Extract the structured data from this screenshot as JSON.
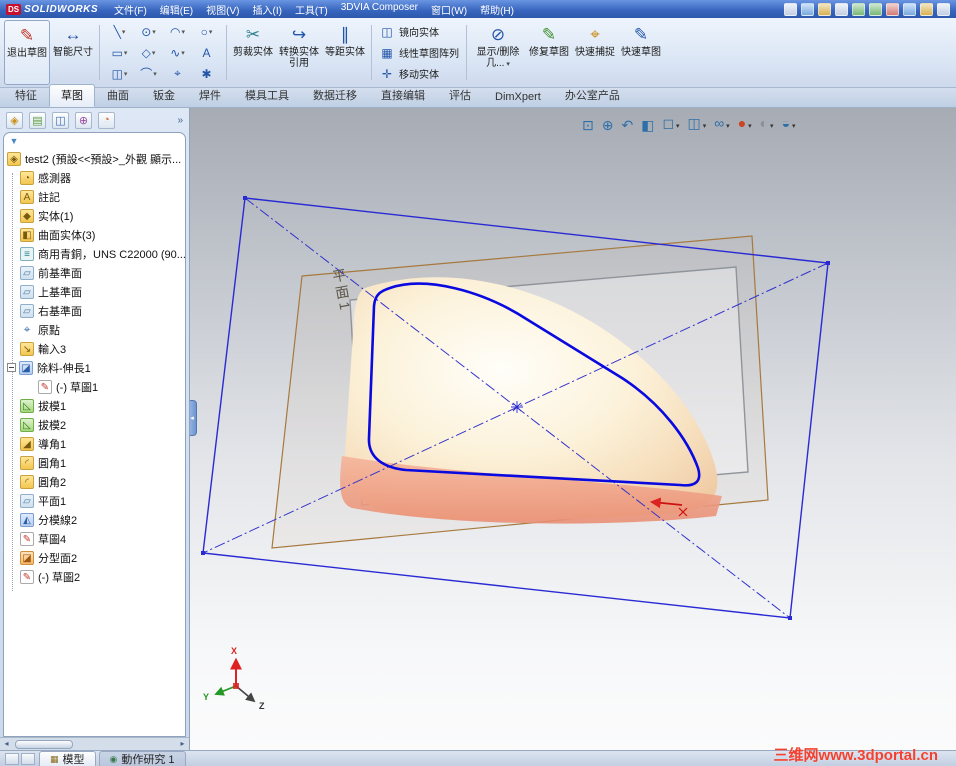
{
  "titlebar": {
    "brand_prefix": "DS",
    "brand": "SOLIDWORKS",
    "menus": [
      "文件(F)",
      "编辑(E)",
      "视图(V)",
      "插入(I)",
      "工具(T)",
      "3DVIA Composer",
      "窗口(W)",
      "帮助(H)"
    ]
  },
  "toolbar": {
    "exit": {
      "label": "退出草图",
      "glyph": "✎"
    },
    "smart_dim": {
      "label": "智能尺寸",
      "glyph": "↔"
    },
    "grid": [
      {
        "g": "╲",
        "n": "line"
      },
      {
        "g": "⊙",
        "n": "circle"
      },
      {
        "g": "◠",
        "n": "arc"
      },
      {
        "g": "○",
        "n": "ellipse"
      },
      {
        "g": "▭",
        "n": "rectangle"
      },
      {
        "g": "◇",
        "n": "polygon"
      },
      {
        "g": "∿",
        "n": "spline"
      },
      {
        "g": "A",
        "n": "text"
      },
      {
        "g": "◫",
        "n": "slot"
      },
      {
        "g": "⌒",
        "n": "sketch-fillet"
      },
      {
        "g": "⌖",
        "n": "centerline"
      },
      {
        "g": "✱",
        "n": "point"
      }
    ],
    "trim": {
      "label": "剪裁实体",
      "glyph": "✂"
    },
    "convert": {
      "label": "转换实体引用",
      "glyph": "↪"
    },
    "offset": {
      "label": "等距实体",
      "glyph": "∥"
    },
    "stack": [
      {
        "label": "镜向实体",
        "glyph": "◫"
      },
      {
        "label": "线性草图阵列",
        "glyph": "▦"
      },
      {
        "label": "移动实体",
        "glyph": "✛"
      }
    ],
    "display_delete": {
      "label": "显示/删除几...",
      "glyph": "⊘"
    },
    "repair": {
      "label": "修复草图",
      "glyph": "✎"
    },
    "quick_snap": {
      "label": "快速捕捉",
      "glyph": "⌖"
    },
    "rapid": {
      "label": "快速草图",
      "glyph": "✎"
    }
  },
  "ribbon": {
    "tabs": [
      "特征",
      "草图",
      "曲面",
      "钣金",
      "焊件",
      "模具工具",
      "数据迁移",
      "直接编辑",
      "评估",
      "DimXpert",
      "办公室产品"
    ]
  },
  "panel": {
    "tabs": [
      {
        "n": "featuremanager",
        "g": "◈"
      },
      {
        "n": "propertymanager",
        "g": "▤"
      },
      {
        "n": "configurationmanager",
        "g": "◫"
      },
      {
        "n": "dimxpertmanager",
        "g": "⊕"
      },
      {
        "n": "displaymanager",
        "g": "◔"
      }
    ]
  },
  "tree": {
    "root": {
      "label": "test2 (預設<<預設>_外觀 顯示...",
      "g": "◈"
    },
    "items": [
      {
        "label": "感測器",
        "g": "◔"
      },
      {
        "label": "註記",
        "g": "A"
      },
      {
        "label": "实体(1)",
        "g": "◆"
      },
      {
        "label": "曲面实体(3)",
        "g": "◧"
      },
      {
        "label": "商用青銅，UNS C22000 (90...",
        "g": "≡"
      },
      {
        "label": "前基準面",
        "g": "▱"
      },
      {
        "label": "上基準面",
        "g": "▱"
      },
      {
        "label": "右基準面",
        "g": "▱"
      },
      {
        "label": "原點",
        "g": "⌖"
      },
      {
        "label": "輸入3",
        "g": "↘"
      },
      {
        "label": "除料-伸長1",
        "g": "◪"
      },
      {
        "label": "(-) 草圖1",
        "g": "✎"
      },
      {
        "label": "拔模1",
        "g": "◺"
      },
      {
        "label": "拔模2",
        "g": "◺"
      },
      {
        "label": "導角1",
        "g": "◢"
      },
      {
        "label": "圓角1",
        "g": "◜"
      },
      {
        "label": "圓角2",
        "g": "◜"
      },
      {
        "label": "平面1",
        "g": "▱"
      },
      {
        "label": "分模線2",
        "g": "◭"
      },
      {
        "label": "草圖4",
        "g": "✎"
      },
      {
        "label": "分型面2",
        "g": "◪"
      },
      {
        "label": "(-) 草圖2",
        "g": "✎"
      }
    ]
  },
  "viewport": {
    "plane_label": "平面1",
    "triad": {
      "x": "X",
      "y": "Y",
      "z": "Z"
    },
    "headsup": [
      {
        "n": "zoom-fit",
        "g": "⊡"
      },
      {
        "n": "zoom-area",
        "g": "⊕"
      },
      {
        "n": "previous-view",
        "g": "↶"
      },
      {
        "n": "section-view",
        "g": "◧"
      },
      {
        "n": "view-orientation",
        "g": "◻"
      },
      {
        "n": "display-style",
        "g": "◫"
      },
      {
        "n": "hide-show-items",
        "g": "∞"
      },
      {
        "n": "edit-appearance",
        "g": "●"
      },
      {
        "n": "apply-scene",
        "g": "◐"
      },
      {
        "n": "view-settings",
        "g": "◒"
      }
    ]
  },
  "statusbar": {
    "model_tab": "模型",
    "motion_tab": "動作研究 1"
  },
  "watermark": "三维网www.3dportal.cn",
  "colors": {
    "sketch_blue": "#0a0ae0",
    "construction_blue": "#3434cc",
    "plane_brown": "#a6793e",
    "part_cream": "#fcf2da",
    "band_salmon": "#f2a68c",
    "watermark_red": "#f4402e"
  }
}
